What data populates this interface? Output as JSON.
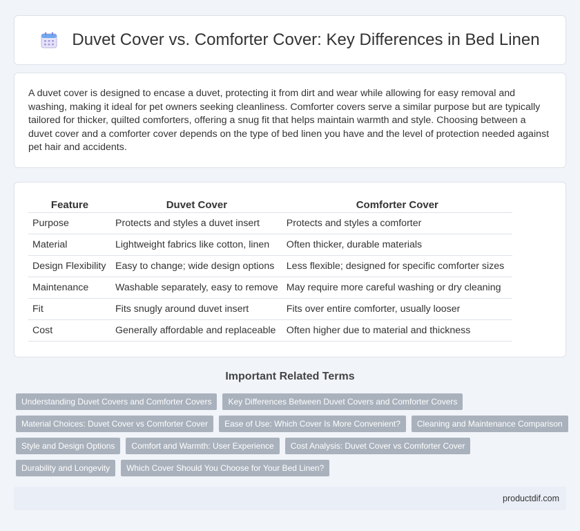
{
  "header": {
    "title": "Duvet Cover vs. Comforter Cover: Key Differences in Bed Linen",
    "icon": "calendar-icon"
  },
  "intro": {
    "text": "A duvet cover is designed to encase a duvet, protecting it from dirt and wear while allowing for easy removal and washing, making it ideal for pet owners seeking cleanliness. Comforter covers serve a similar purpose but are typically tailored for thicker, quilted comforters, offering a snug fit that helps maintain warmth and style. Choosing between a duvet cover and a comforter cover depends on the type of bed linen you have and the level of protection needed against pet hair and accidents."
  },
  "table": {
    "headers": [
      "Feature",
      "Duvet Cover",
      "Comforter Cover"
    ],
    "rows": [
      [
        "Purpose",
        "Protects and styles a duvet insert",
        "Protects and styles a comforter"
      ],
      [
        "Material",
        "Lightweight fabrics like cotton, linen",
        "Often thicker, durable materials"
      ],
      [
        "Design Flexibility",
        "Easy to change; wide design options",
        "Less flexible; designed for specific comforter sizes"
      ],
      [
        "Maintenance",
        "Washable separately, easy to remove",
        "May require more careful washing or dry cleaning"
      ],
      [
        "Fit",
        "Fits snugly around duvet insert",
        "Fits over entire comforter, usually looser"
      ],
      [
        "Cost",
        "Generally affordable and replaceable",
        "Often higher due to material and thickness"
      ]
    ]
  },
  "related": {
    "title": "Important Related Terms",
    "tags": [
      "Understanding Duvet Covers and Comforter Covers",
      "Key Differences Between Duvet Covers and Comforter Covers",
      "Material Choices: Duvet Cover vs Comforter Cover",
      "Ease of Use: Which Cover Is More Convenient?",
      "Cleaning and Maintenance Comparison",
      "Style and Design Options",
      "Comfort and Warmth: User Experience",
      "Cost Analysis: Duvet Cover vs Comforter Cover",
      "Durability and Longevity",
      "Which Cover Should You Choose for Your Bed Linen?"
    ]
  },
  "footer": {
    "site": "productdif.com"
  },
  "colors": {
    "background": "#f1f4f9",
    "tag": "#a9b1bc",
    "footer": "#e9eef7"
  }
}
